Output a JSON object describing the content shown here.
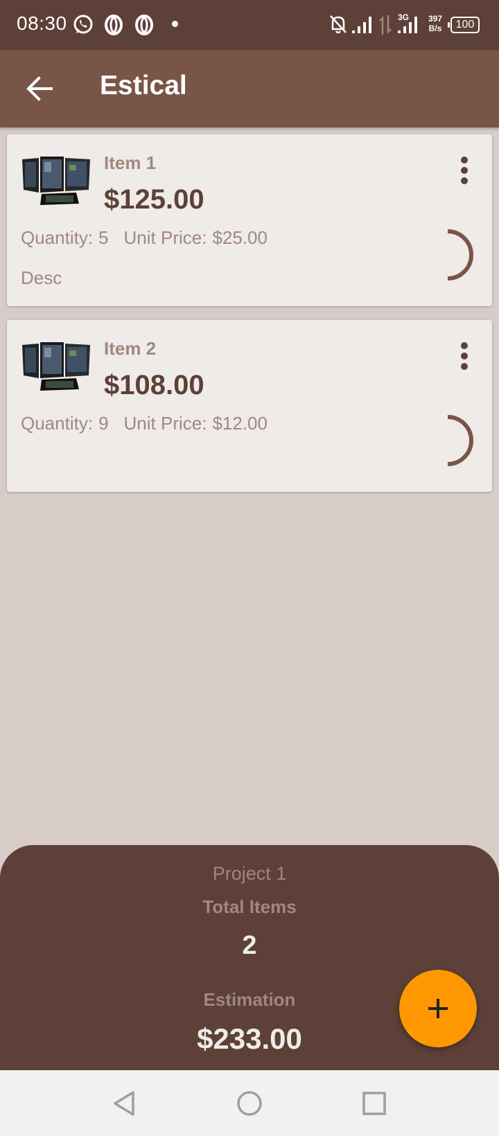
{
  "status_bar": {
    "time": "08:30",
    "network_type": "3G",
    "speed_value": "397",
    "speed_unit": "B/s",
    "battery": "100",
    "icons": [
      "whatsapp-icon",
      "opera-icon",
      "opera-icon",
      "notifications-off-icon",
      "signal-icon",
      "data-arrows-icon",
      "signal-icon"
    ]
  },
  "app_bar": {
    "title": "Estical",
    "back_icon": "arrow-back-icon"
  },
  "items": [
    {
      "name": "Item 1",
      "total": "$125.00",
      "quantity_label": "Quantity:",
      "quantity": "5",
      "unit_price_label": "Unit Price:",
      "unit_price": "$25.00",
      "description": "Desc"
    },
    {
      "name": "Item 2",
      "total": "$108.00",
      "quantity_label": "Quantity:",
      "quantity": "9",
      "unit_price_label": "Unit Price:",
      "unit_price": "$12.00",
      "description": ""
    }
  ],
  "summary": {
    "project_name": "Project 1",
    "total_items_label": "Total Items",
    "total_items": "2",
    "estimation_label": "Estimation",
    "estimation": "$233.00"
  },
  "fab": {
    "icon": "plus-icon"
  },
  "nav_bar": {
    "icons": [
      "back-triangle-icon",
      "home-circle-icon",
      "recents-square-icon"
    ]
  },
  "colors": {
    "primary_dark": "#5d4037",
    "primary": "#795548",
    "background": "#d7ccc8",
    "card": "#efebe9",
    "accent": "#ff9800",
    "secondary_text": "#a1887f"
  }
}
